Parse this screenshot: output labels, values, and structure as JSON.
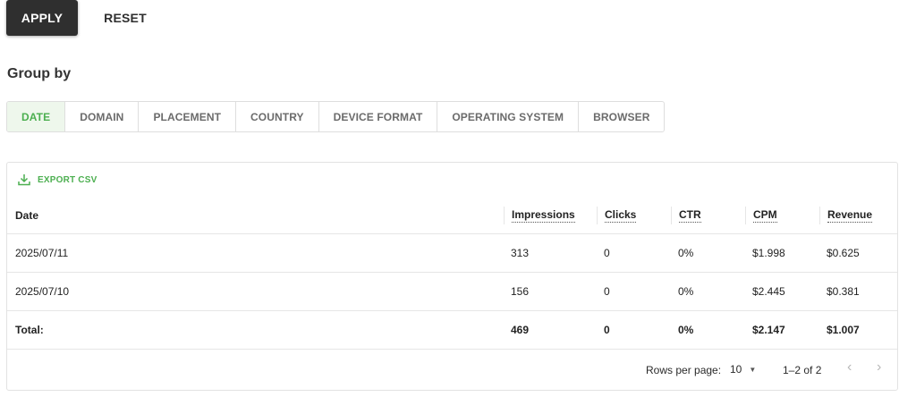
{
  "actions": {
    "apply_label": "APPLY",
    "reset_label": "RESET"
  },
  "group_by": {
    "label": "Group by",
    "tabs": [
      {
        "label": "DATE",
        "active": true
      },
      {
        "label": "DOMAIN",
        "active": false
      },
      {
        "label": "PLACEMENT",
        "active": false
      },
      {
        "label": "COUNTRY",
        "active": false
      },
      {
        "label": "DEVICE FORMAT",
        "active": false
      },
      {
        "label": "OPERATING SYSTEM",
        "active": false
      },
      {
        "label": "BROWSER",
        "active": false
      }
    ]
  },
  "report": {
    "export_label": "EXPORT CSV",
    "columns": {
      "date": "Date",
      "impressions": "Impressions",
      "clicks": "Clicks",
      "ctr": "CTR",
      "cpm": "CPM",
      "revenue": "Revenue"
    },
    "rows": [
      {
        "date": "2025/07/11",
        "impressions": "313",
        "clicks": "0",
        "ctr": "0%",
        "cpm": "$1.998",
        "revenue": "$0.625"
      },
      {
        "date": "2025/07/10",
        "impressions": "156",
        "clicks": "0",
        "ctr": "0%",
        "cpm": "$2.445",
        "revenue": "$0.381"
      }
    ],
    "total": {
      "label": "Total:",
      "impressions": "469",
      "clicks": "0",
      "ctr": "0%",
      "cpm": "$2.147",
      "revenue": "$1.007"
    }
  },
  "pagination": {
    "rows_per_page_label": "Rows per page:",
    "rows_per_page_value": "10",
    "range_label": "1–2 of 2"
  },
  "colors": {
    "accent": "#4caf50",
    "primary_button": "#2f2f2f",
    "active_tab_bg": "#eef7ec"
  },
  "icons": {
    "export": "download-icon",
    "dropdown": "caret-down-icon",
    "prev": "chevron-left-icon",
    "next": "chevron-right-icon"
  }
}
